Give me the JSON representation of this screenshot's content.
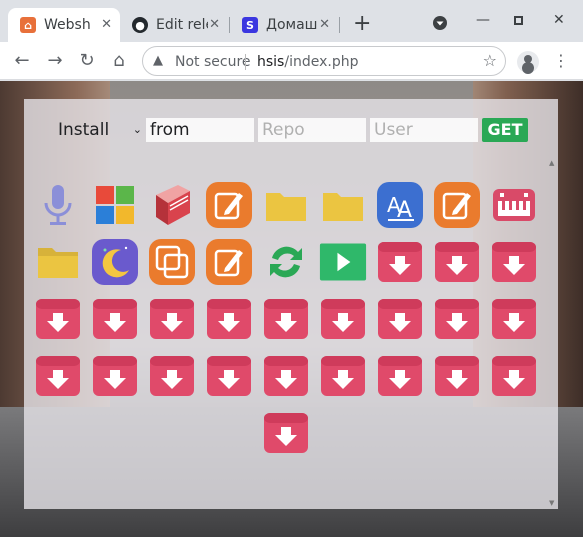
{
  "tabs": [
    {
      "title": "Websh",
      "favicon": "websh-favicon",
      "color": "#e8703a",
      "active": true
    },
    {
      "title": "Edit rele",
      "favicon": "github-favicon",
      "color": "#24292e",
      "active": false
    },
    {
      "title": "Домаш",
      "favicon": "s-favicon",
      "color": "#3b37e0",
      "glyph": "S",
      "active": false
    }
  ],
  "toolbar": {
    "security_label": "Not secure",
    "url_host": "hsis",
    "url_path": "/index.php"
  },
  "form": {
    "action_selected": "Install",
    "from_value": "from",
    "repo_placeholder": "Repo",
    "user_placeholder": "User",
    "get_label": "GET"
  },
  "apps": [
    {
      "name": "microphone-app-icon",
      "kind": "mic"
    },
    {
      "name": "windows-app-icon",
      "kind": "windows"
    },
    {
      "name": "book-app-icon",
      "kind": "book"
    },
    {
      "name": "editor-app-icon",
      "kind": "edit"
    },
    {
      "name": "folder-app-icon",
      "kind": "folder"
    },
    {
      "name": "folder-app-icon",
      "kind": "folder"
    },
    {
      "name": "translate-app-icon",
      "kind": "translate"
    },
    {
      "name": "editor-app-icon",
      "kind": "edit"
    },
    {
      "name": "piano-app-icon",
      "kind": "piano"
    },
    {
      "name": "folder-app-icon",
      "kind": "folder2"
    },
    {
      "name": "night-mode-app-icon",
      "kind": "moon"
    },
    {
      "name": "copy-app-icon",
      "kind": "copy"
    },
    {
      "name": "editor-app-icon",
      "kind": "edit"
    },
    {
      "name": "sync-app-icon",
      "kind": "sync"
    },
    {
      "name": "play-app-icon",
      "kind": "play"
    },
    {
      "name": "download-app-icon",
      "kind": "download"
    },
    {
      "name": "download-app-icon",
      "kind": "download"
    },
    {
      "name": "download-app-icon",
      "kind": "download"
    },
    {
      "name": "download-app-icon",
      "kind": "download"
    },
    {
      "name": "download-app-icon",
      "kind": "download"
    },
    {
      "name": "download-app-icon",
      "kind": "download"
    },
    {
      "name": "download-app-icon",
      "kind": "download"
    },
    {
      "name": "download-app-icon",
      "kind": "download"
    },
    {
      "name": "download-app-icon",
      "kind": "download"
    },
    {
      "name": "download-app-icon",
      "kind": "download"
    },
    {
      "name": "download-app-icon",
      "kind": "download"
    },
    {
      "name": "download-app-icon",
      "kind": "download"
    },
    {
      "name": "download-app-icon",
      "kind": "download"
    },
    {
      "name": "download-app-icon",
      "kind": "download"
    },
    {
      "name": "download-app-icon",
      "kind": "download"
    },
    {
      "name": "download-app-icon",
      "kind": "download"
    },
    {
      "name": "download-app-icon",
      "kind": "download"
    },
    {
      "name": "download-app-icon",
      "kind": "download"
    },
    {
      "name": "download-app-icon",
      "kind": "download"
    },
    {
      "name": "download-app-icon",
      "kind": "download"
    },
    {
      "name": "download-app-icon",
      "kind": "download"
    },
    {
      "name": "download-app-icon",
      "kind": "download"
    }
  ],
  "colors": {
    "orange": "#ea7b2d",
    "folder": "#ebc541",
    "download": "#e04a6a",
    "green": "#2aa855",
    "blue": "#3c6fd0",
    "purple": "#6a5acd"
  }
}
